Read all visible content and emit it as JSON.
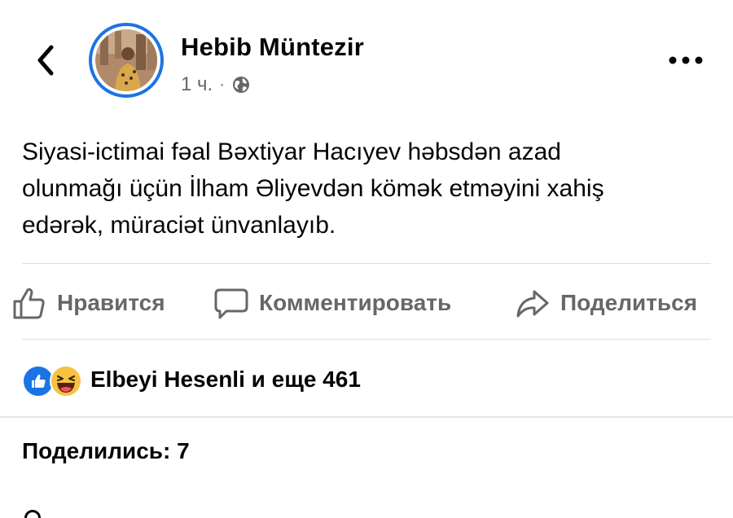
{
  "post": {
    "author": "Hebib Müntezir",
    "time": "1 ч.",
    "separator": "·",
    "text_lines": [
      "Siyasi-ictimai fəal Bəxtiyar Hacıyev həbsdən azad",
      "olunmağı üçün İlham Əliyevdən kömək etməyini xahiş",
      "edərək, müraciət ünvanlayıb."
    ]
  },
  "actions": {
    "like": "Нравится",
    "comment": "Комментировать",
    "share": "Поделиться"
  },
  "reactions": {
    "summary": "Elbeyi Hesenli и еще 461",
    "icons": [
      "like-icon",
      "haha-icon"
    ]
  },
  "shares": {
    "label": "Поделились: 7"
  },
  "colors": {
    "accent": "#1b74e4",
    "text": "#050505",
    "secondary": "#65676b",
    "divider": "#dadde1"
  }
}
